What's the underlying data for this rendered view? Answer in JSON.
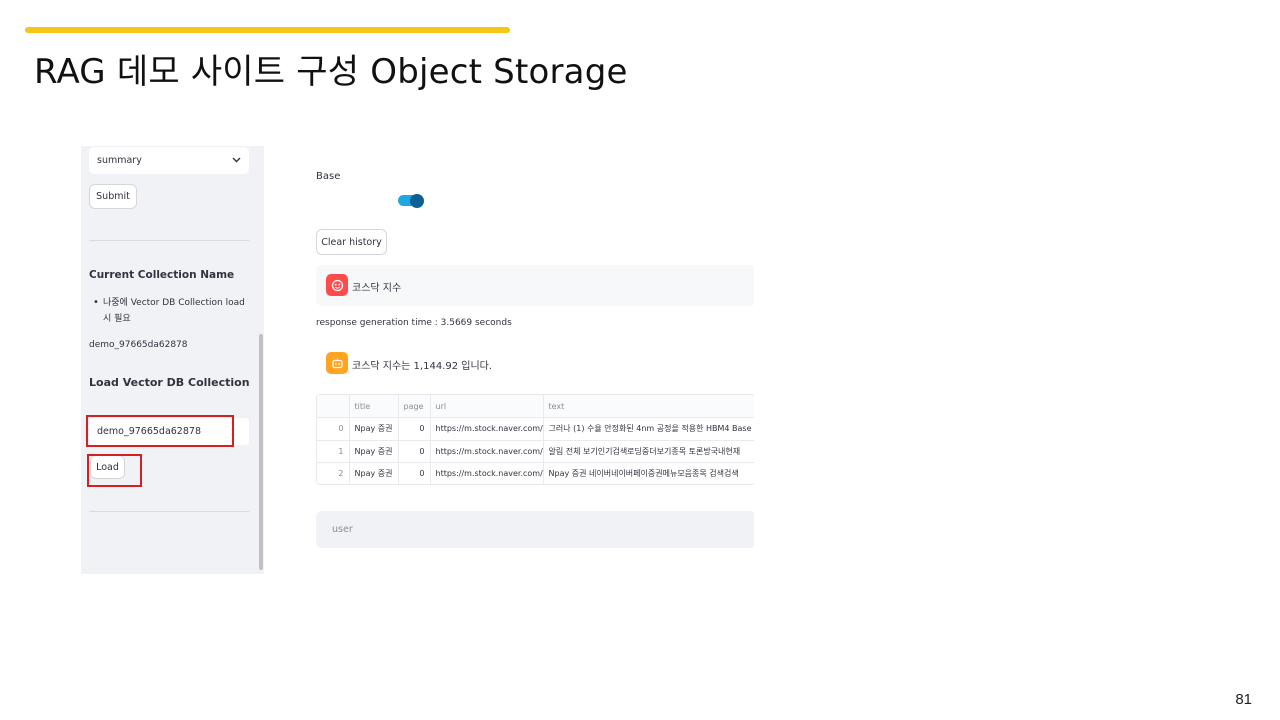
{
  "slide": {
    "title": "RAG 데모 사이트 구성 Object Storage",
    "page_number": "81"
  },
  "colors": {
    "accent_bar": "#f5c518",
    "highlight_box": "#d32020",
    "toggle_on": "#1ea7e1"
  },
  "sidebar": {
    "select_value": "summary",
    "select_icon": "chevron-down-icon",
    "submit_label": "Submit",
    "current_collection_heading": "Current Collection Name",
    "note_bullet": "나중에 Vector DB Collection load 시 필요",
    "current_collection_value": "demo_97665da62878",
    "load_heading": "Load Vector DB Collection",
    "collection_input_value": "demo_97665da62878",
    "load_label": "Load"
  },
  "main": {
    "toggle_label": "Base",
    "toggle_on": true,
    "clear_history_label": "Clear history",
    "user_message": "코스닥 지수",
    "response_time": "response generation time : 3.5669 seconds",
    "assistant_message": "코스닥 지수는 1,144.92 입니다.",
    "table": {
      "columns": [
        "",
        "title",
        "page",
        "url",
        "text"
      ],
      "rows": [
        [
          "0",
          "Npay 증권",
          "0",
          "https://m.stock.naver.com/",
          "그러나 (1) 수율 안정화된 4nm 공정을 적용한 HBM4 Base"
        ],
        [
          "1",
          "Npay 증권",
          "0",
          "https://m.stock.naver.com/",
          "알림 전체 보기인기검색로딩중더보기종목 토론방국내현재"
        ],
        [
          "2",
          "Npay 증권",
          "0",
          "https://m.stock.naver.com/",
          "Npay 증권 네이버네이버페이증권메뉴모음종목 검색검색"
        ]
      ]
    },
    "chat_input_placeholder": "user"
  }
}
